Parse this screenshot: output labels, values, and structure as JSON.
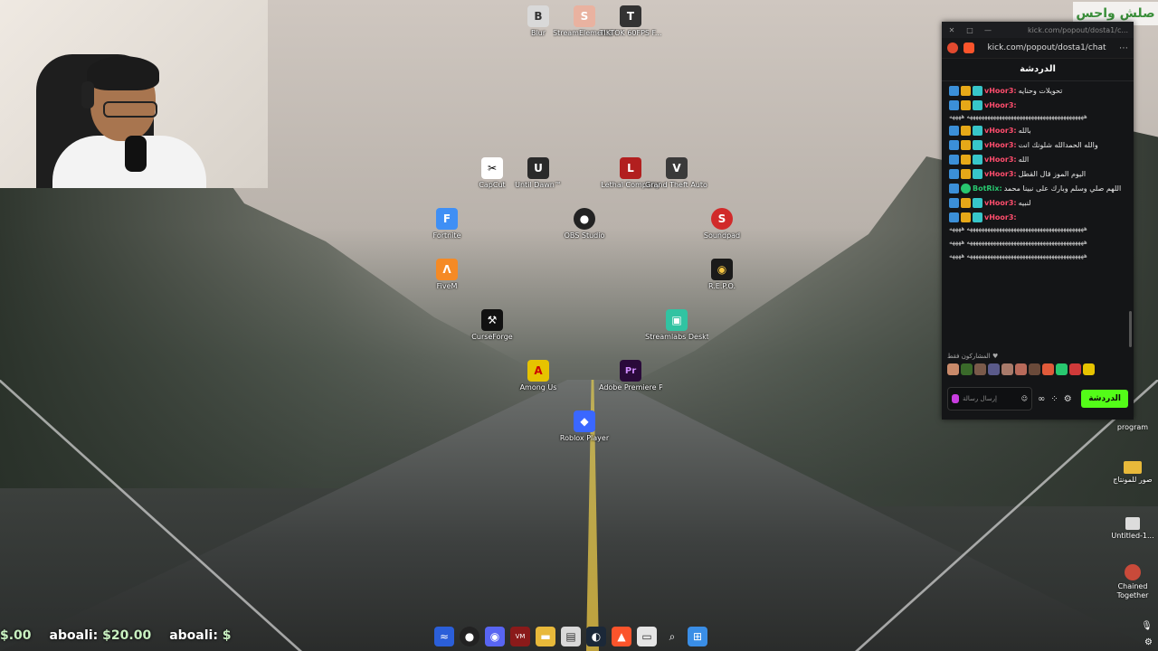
{
  "watermark": {
    "text": "صلش واحس"
  },
  "desktop_icons": [
    {
      "label": "Blur",
      "color": "#d9d9d9",
      "glyph": "B",
      "name": "blur-icon"
    },
    {
      "label": "StreamElements SE.Live",
      "color": "#e9b2a0",
      "glyph": "S",
      "name": "streamelements-icon"
    },
    {
      "label": "TIKTOK 60FPS F...",
      "color": "#333333",
      "glyph": "T",
      "name": "tiktok-icon"
    },
    {
      "label": "CapCut",
      "color": "#ffffff",
      "glyph": "✂",
      "name": "capcut-icon"
    },
    {
      "label": "Until Dawn™",
      "color": "#2a2a2a",
      "glyph": "U",
      "name": "until-dawn-icon"
    },
    {
      "label": "Lethal Company",
      "color": "#b21f1f",
      "glyph": "L",
      "name": "lethal-company-icon"
    },
    {
      "label": "Grand Theft Auto V En...",
      "color": "#3a3a3a",
      "glyph": "V",
      "name": "gta-icon"
    },
    {
      "label": "Fortnite",
      "color": "#3f8ff5",
      "glyph": "F",
      "name": "fortnite-icon"
    },
    {
      "label": "OBS Studio",
      "color": "#222222",
      "glyph": "●",
      "name": "obs-icon"
    },
    {
      "label": "Soundpad",
      "color": "#d12a2a",
      "glyph": "S",
      "name": "soundpad-icon"
    },
    {
      "label": "FiveM",
      "color": "#f58a25",
      "glyph": "Λ",
      "name": "fivem-icon"
    },
    {
      "label": "R.E.P.O.",
      "color": "#1a1a1a",
      "glyph": "◉",
      "name": "repo-icon"
    },
    {
      "label": "CurseForge",
      "color": "#111111",
      "glyph": "⚒",
      "name": "curseforge-icon"
    },
    {
      "label": "Streamlabs Desktop",
      "color": "#31c3a2",
      "glyph": "▣",
      "name": "streamlabs-icon"
    },
    {
      "label": "Among Us",
      "color": "#e6c300",
      "glyph": "A",
      "name": "among-us-icon"
    },
    {
      "label": "Adobe Premiere P...",
      "color": "#2a0a3a",
      "glyph": "Pr",
      "name": "premiere-icon"
    },
    {
      "label": "Roblox Player",
      "color": "#3a67ff",
      "glyph": "◆",
      "name": "roblox-icon"
    }
  ],
  "right_column": [
    {
      "label": "program",
      "name": "program-folder"
    },
    {
      "label": "صور للمونتاج",
      "name": "montage-folder"
    },
    {
      "label": "Untitled-1...",
      "name": "untitled-file"
    },
    {
      "label": "Chained Together",
      "name": "chained-together-icon"
    }
  ],
  "chat": {
    "window_url_short": "kick.com/popout/dosta1/c...",
    "address_url": "kick.com/popout/dosta1/chat",
    "header": "الدردشة",
    "messages": [
      {
        "user": "vHoor3:",
        "user_color": "#ff4d6d",
        "text": "تحويلات وحنايه",
        "long": ""
      },
      {
        "user": "vHoor3:",
        "user_color": "#ff4d6d",
        "text": "",
        "long": "ههههههههههههههههههههههههههههههههههههههههه ههههه"
      },
      {
        "user": "vHoor3:",
        "user_color": "#ff4d6d",
        "text": "بالله",
        "long": ""
      },
      {
        "user": "vHoor3:",
        "user_color": "#ff4d6d",
        "text": "والله الحمدالله شلونك انت",
        "long": ""
      },
      {
        "user": "vHoor3:",
        "user_color": "#ff4d6d",
        "text": "الله",
        "long": ""
      },
      {
        "user": "vHoor3:",
        "user_color": "#ff4d6d",
        "text": "اليوم الموز قال القطل",
        "long": ""
      },
      {
        "user": "BotRix:",
        "user_color": "#28c76f",
        "text": "اللهم صلي وسلم وبارك على نبينا محمد",
        "long": ""
      },
      {
        "user": "vHoor3:",
        "user_color": "#ff4d6d",
        "text": "لنبيه",
        "long": ""
      },
      {
        "user": "vHoor3:",
        "user_color": "#ff4d6d",
        "text": "",
        "long": "ههههههههههههههههههههههههههههههههههههههههه ههههه"
      }
    ],
    "extra_lines": [
      "ههههههههههههههههههههههههههههههههههههههههه ههههه",
      "ههههههههههههههههههههههههههههههههههههههههه ههههه"
    ],
    "subs_title": "المشاركون فقط ♥",
    "input_placeholder": "إرسال رسالة",
    "send_label": "الدردشة"
  },
  "ticker": [
    {
      "name": "",
      "amount": "$.00"
    },
    {
      "name": "aboali:",
      "amount": "$20.00"
    },
    {
      "name": "aboali:",
      "amount": "$"
    }
  ]
}
